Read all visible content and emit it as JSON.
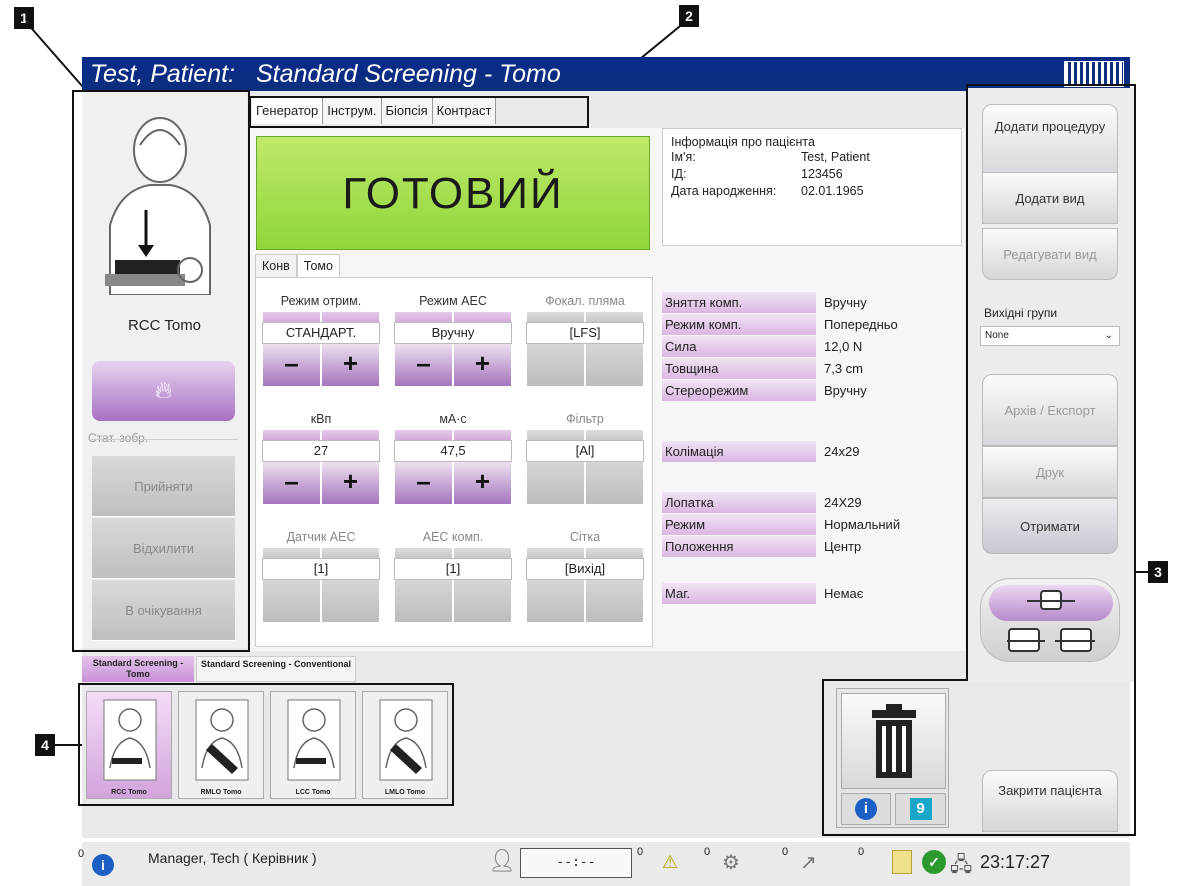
{
  "callouts": [
    "1",
    "2",
    "3",
    "4"
  ],
  "title": {
    "patient": "Test, Patient:",
    "procedure": "Standard Screening - Tomo"
  },
  "left": {
    "view_label": "RCC Tomo",
    "image_status_label": "Стат. зобр.",
    "buttons": [
      "Прийняти",
      "Відхилити",
      "В очікування"
    ]
  },
  "tabs": [
    "Генератор",
    "Інструм.",
    "Біопсія",
    "Контраст"
  ],
  "ready_text": "ГОТОВИЙ",
  "patient_info": {
    "header": "Інформація про пацієнта",
    "name_label": "Ім'я:",
    "name": "Test, Patient",
    "id_label": "ІД:",
    "id": "123456",
    "dob_label": "Дата народження:",
    "dob": "02.01.1965"
  },
  "subtabs": [
    "Конв",
    "Томо"
  ],
  "controls": [
    {
      "title": "Режим отрим.",
      "value": "СТАНДАРТ.",
      "active": true
    },
    {
      "title": "Режим AEC",
      "value": "Вручну",
      "active": true
    },
    {
      "title": "Фокал. пляма",
      "value": "[LFS]",
      "active": false
    },
    {
      "title": "кВп",
      "value": "27",
      "active": true
    },
    {
      "title": "мА·с",
      "value": "47,5",
      "active": true
    },
    {
      "title": "Фільтр",
      "value": "[Al]",
      "active": false
    },
    {
      "title": "Датчик AEC",
      "value": "[1]",
      "active": false
    },
    {
      "title": "AEC комп.",
      "value": "[1]",
      "active": false
    },
    {
      "title": "Сітка",
      "value": "[Вихід]",
      "active": false
    }
  ],
  "minus": "–",
  "plus": "+",
  "params": [
    {
      "name": "Зняття комп.",
      "value": "Вручну"
    },
    {
      "name": "Режим комп.",
      "value": "Попередньо"
    },
    {
      "name": "Сила",
      "value": "12,0 N"
    },
    {
      "name": "Товщина",
      "value": "7,3 cm"
    },
    {
      "name": "Стереорежим",
      "value": "Вручну"
    },
    {
      "name": "Колімація",
      "value": "24x29"
    },
    {
      "name": "Лопатка",
      "value": "24X29"
    },
    {
      "name": "Режим",
      "value": "Нормальний"
    },
    {
      "name": "Положення",
      "value": "Центр"
    },
    {
      "name": "Маг.",
      "value": "Немає"
    }
  ],
  "right": {
    "add_procedure": "Додати процедуру",
    "add_view": "Додати вид",
    "edit_view": "Редагувати вид",
    "output_groups_label": "Вихідні групи",
    "output_groups_value": "None",
    "archive_export": "Архів / Експорт",
    "print": "Друк",
    "retrieve": "Отримати",
    "close_patient": "Закрити пацієнта"
  },
  "procedure_tabs": [
    "Standard Screening - Tomo",
    "Standard Screening - Conventional"
  ],
  "thumbnails": [
    "RCC Tomo",
    "RMLO Tomo",
    "LCC Tomo",
    "LMLO Tomo"
  ],
  "status": {
    "count0": "0",
    "user": "Manager, Tech ( Керівник )",
    "clock_display": "--:--",
    "counts": [
      "0",
      "0",
      "0",
      "0"
    ],
    "time": "23:17:27"
  }
}
